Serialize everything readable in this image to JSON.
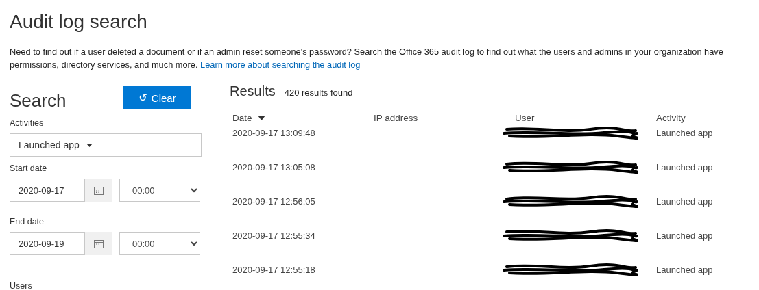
{
  "page": {
    "title": "Audit log search",
    "intro_lines": [
      "Need to find out if a user deleted a document or if an admin reset someone's password? Search the Office 365 audit log to find out what the users and admins in your organization have",
      "permissions, directory services, and much more."
    ],
    "intro_link": "Learn more about searching the audit log"
  },
  "search": {
    "heading": "Search",
    "clear_button": {
      "icon": "↺",
      "label": "Clear"
    },
    "activities": {
      "label": "Activities",
      "value": "Launched app"
    },
    "start_date": {
      "label": "Start date",
      "date": "2020-09-17",
      "time": "00:00"
    },
    "end_date": {
      "label": "End date",
      "date": "2020-09-19",
      "time": "00:00"
    },
    "users": {
      "label": "Users"
    }
  },
  "results": {
    "heading": "Results",
    "count": "420 results found",
    "columns": [
      {
        "label": "Date",
        "sorted": true
      },
      {
        "label": "IP address",
        "sorted": false
      },
      {
        "label": "User",
        "sorted": false
      },
      {
        "label": "Activity",
        "sorted": false
      }
    ],
    "rows": [
      {
        "date": "2020-09-17 13:09:48",
        "user_redacted": true,
        "activity": "Launched app"
      },
      {
        "date": "2020-09-17 13:05:08",
        "user_redacted": true,
        "activity": "Launched app"
      },
      {
        "date": "2020-09-17 12:56:05",
        "user_redacted": true,
        "activity": "Launched app"
      },
      {
        "date": "2020-09-17 12:55:34",
        "user_redacted": true,
        "activity": "Launched app"
      },
      {
        "date": "2020-09-17 12:55:18",
        "user_redacted": true,
        "activity": "Launched app"
      }
    ]
  }
}
